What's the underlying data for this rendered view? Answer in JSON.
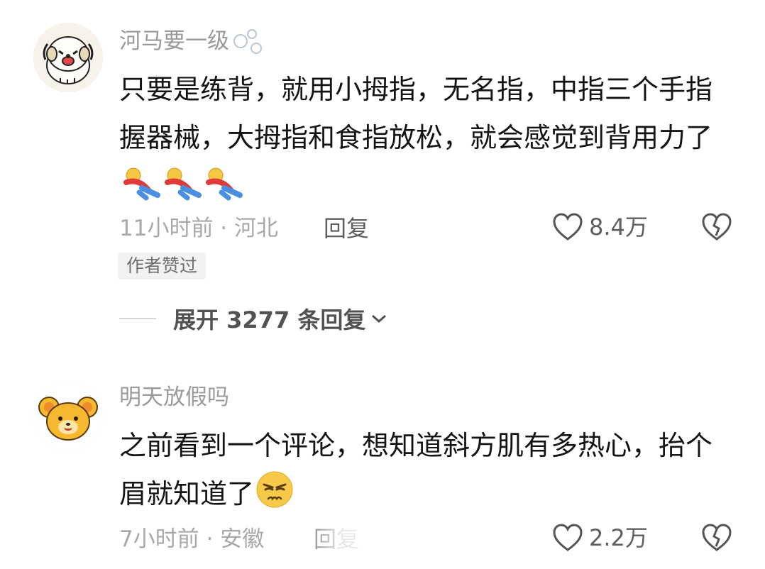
{
  "comments": [
    {
      "username": "河马要一级",
      "content": "只要是练背，就用小拇指，无名指，中指三个手指握器械，大拇指和食指放松，就会感觉到背用力了",
      "time_location": "11小时前 · 河北",
      "reply_label": "回复",
      "likes": "8.4万",
      "author_tag": "作者赞过",
      "expand_label": "展开 3277 条回复",
      "avatar_icon": "puppy-avatar-icon",
      "trailing_emoji_icon": "fallen-figure-emoji-icon"
    },
    {
      "username": "明天放假吗",
      "content": "之前看到一个评论，想知道斜方肌有多热心，抬个眉就知道了",
      "time_location": "7小时前 · 安徽",
      "reply_label": "回复",
      "likes": "2.2万",
      "avatar_icon": "bear-avatar-icon",
      "trailing_emoji_icon": "frowning-face-emoji-icon"
    }
  ],
  "colors": {
    "text_primary": "#141414",
    "text_secondary": "#9a9a9a",
    "tag_bg": "#f2f2f2",
    "accent_red": "#e03b3b",
    "accent_blue": "#4a8fe0",
    "emoji_yellow": "#f5c842"
  }
}
